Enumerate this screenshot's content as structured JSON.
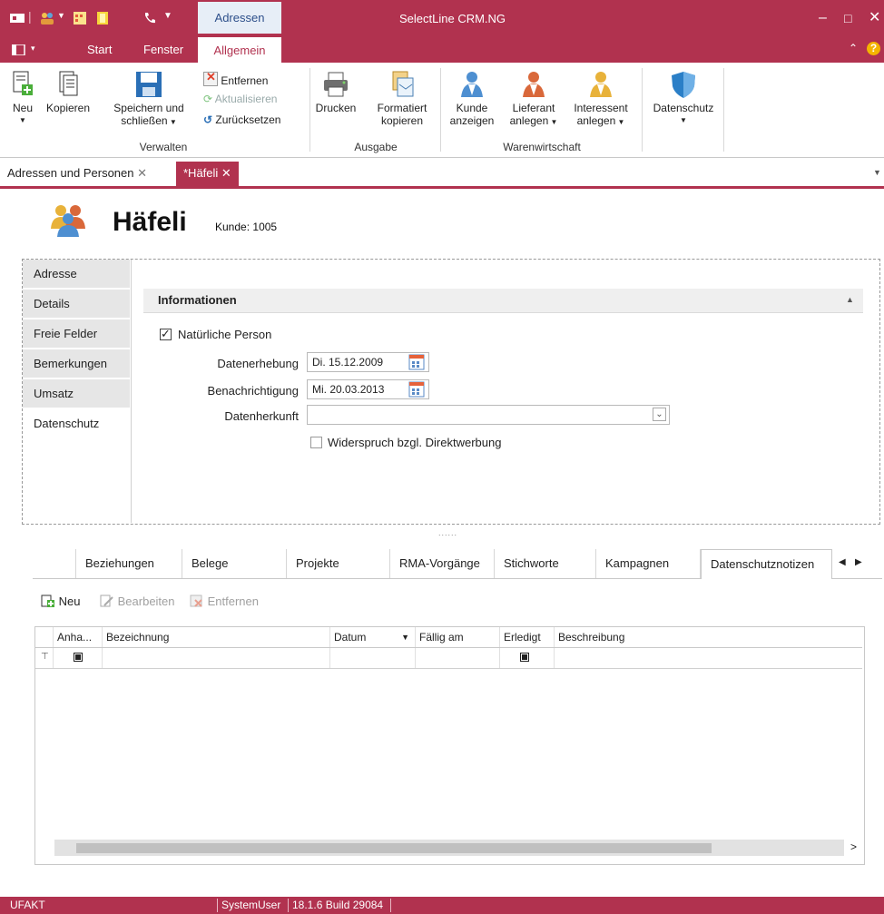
{
  "titlebar": {
    "context_tab": "Adressen",
    "app_title": "SelectLine CRM.NG",
    "minimize": "–",
    "maximize": "□",
    "close": "✕"
  },
  "menu": {
    "tabs": [
      "Start",
      "Fenster",
      "Allgemein"
    ],
    "help": "?"
  },
  "ribbon": {
    "new_label": "Neu",
    "copy_label": "Kopieren",
    "save_close_label_1": "Speichern und",
    "save_close_label_2": "schließen",
    "remove_label": "Entfernen",
    "refresh_label": "Aktualisieren",
    "reset_label": "Zurücksetzen",
    "group_manage": "Verwalten",
    "print_label": "Drucken",
    "copy_formatted_1": "Formatiert",
    "copy_formatted_2": "kopieren",
    "group_output": "Ausgabe",
    "show_customer_1": "Kunde",
    "show_customer_2": "anzeigen",
    "create_supplier_1": "Lieferant",
    "create_supplier_2": "anlegen",
    "create_prospect_1": "Interessent",
    "create_prospect_2": "anlegen",
    "group_erp": "Warenwirtschaft",
    "privacy_label": "Datenschutz"
  },
  "doctabs": [
    {
      "label": "Adressen und Personen"
    },
    {
      "label": "*Häfeli"
    }
  ],
  "entity": {
    "name": "Häfeli",
    "kunde_label": "Kunde:",
    "kunde_nr": "1005"
  },
  "side_tabs": [
    "Adresse",
    "Details",
    "Freie Felder",
    "Bemerkungen",
    "Umsatz",
    "Datenschutz"
  ],
  "info": {
    "header": "Informationen",
    "natural_person": "Natürliche Person",
    "collection_label": "Datenerhebung",
    "collection_value": "Di. 15.12.2009",
    "notify_label": "Benachrichtigung",
    "notify_value": "Mi. 20.03.2013",
    "origin_label": "Datenherkunft",
    "origin_value": "",
    "objection_label": "Widerspruch bzgl. Direktwerbung"
  },
  "bottom_tabs": [
    "Beziehungen",
    "Belege",
    "Projekte",
    "RMA-Vorgänge",
    "Stichworte",
    "Kampagnen",
    "Datenschutznotizen"
  ],
  "grid_toolbar": {
    "new": "Neu",
    "edit": "Bearbeiten",
    "remove": "Entfernen"
  },
  "grid": {
    "columns": [
      "Anha...",
      "Bezeichnung",
      "Datum",
      "Fällig am",
      "Erledigt",
      "Beschreibung"
    ]
  },
  "status": {
    "left": "UFAKT",
    "user": "SystemUser",
    "version": "18.1.6 Build 29084"
  },
  "colors": {
    "accent": "#b1324f",
    "context_tab": "#e7eef7"
  }
}
